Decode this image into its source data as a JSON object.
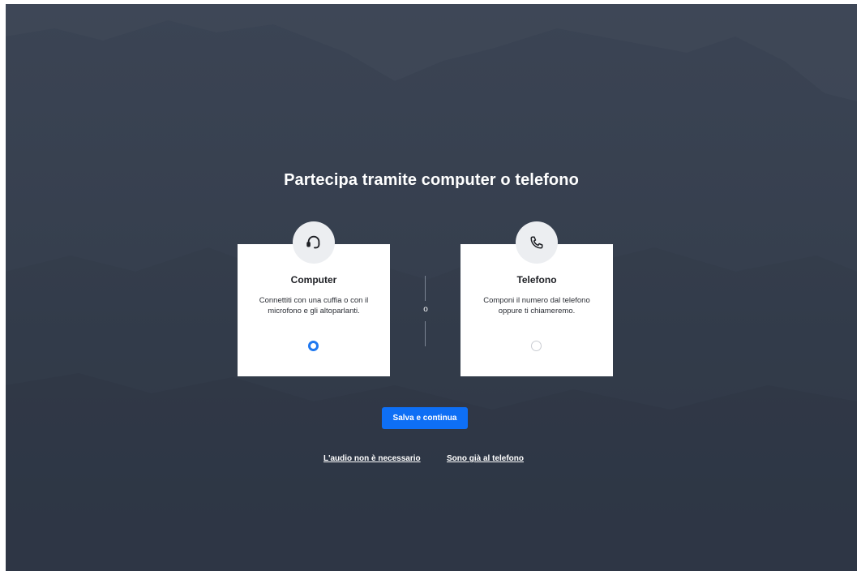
{
  "dialog": {
    "title": "Partecipa tramite computer o telefono",
    "separator": "o"
  },
  "options": [
    {
      "title": "Computer",
      "description": "Connettiti con una cuffia o con il microfono e gli altoparlanti.",
      "icon": "headset-icon",
      "selected": true
    },
    {
      "title": "Telefono",
      "description": "Componi il numero dal telefono oppure ti chiameremo.",
      "icon": "phone-icon",
      "selected": false
    }
  ],
  "actions": {
    "primary_label": "Salva e continua",
    "no_audio_label": "L'audio non è necessario",
    "on_phone_label": "Sono già al telefono"
  },
  "colors": {
    "background": "#363f4e",
    "primary": "#0e6ff5",
    "radio_selected": "#1f78f0"
  }
}
